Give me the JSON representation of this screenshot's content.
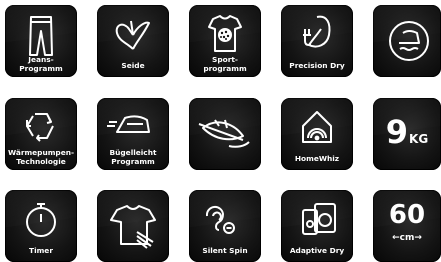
{
  "tiles": {
    "jeans": {
      "label_1": "Jeans-",
      "label_2": "Programm"
    },
    "silk": {
      "label": "Seide"
    },
    "sport": {
      "label_1": "Sport-",
      "label_2": "programm"
    },
    "precision_dry": {
      "label": "Precision Dry"
    },
    "ironing": {},
    "heat_pump": {
      "label_1": "Wärmepumpen-",
      "label_2": "Technologie"
    },
    "easy_iron": {
      "label_1": "Bügelleicht",
      "label_2": "Programm"
    },
    "feather": {},
    "homewhiz": {
      "label": "HomeWhiz"
    },
    "capacity": {
      "value": "9",
      "unit": "KG"
    },
    "timer": {
      "label": "Timer"
    },
    "shirt_fresh": {},
    "silent_spin": {
      "label": "Silent Spin"
    },
    "adaptive_dry": {
      "label": "Adaptive Dry"
    },
    "width": {
      "value": "60",
      "unit": "cm"
    }
  }
}
